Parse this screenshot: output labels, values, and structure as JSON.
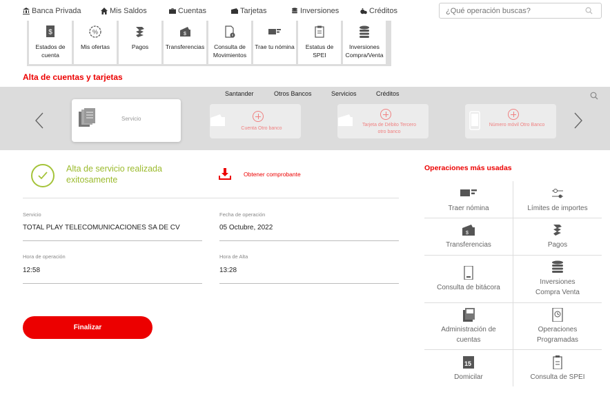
{
  "nav": {
    "banca_privada": "Banca Privada",
    "mis_saldos": "Mis Saldos",
    "cuentas": "Cuentas",
    "tarjetas": "Tarjetas",
    "inversiones": "Inversiones",
    "creditos": "Créditos",
    "search_placeholder": "¿Qué operación buscas?"
  },
  "tiles": [
    {
      "label": "Estados de cuenta",
      "icon": "dollar-doc-icon"
    },
    {
      "label": "Mis ofertas",
      "icon": "percent-badge-icon"
    },
    {
      "label": "Pagos",
      "icon": "hand-coin-icon"
    },
    {
      "label": "Transferencias",
      "icon": "wallet-icon"
    },
    {
      "label": "Consulta de Movimientos",
      "icon": "document-info-icon"
    },
    {
      "label": "Trae tu nómina",
      "icon": "payroll-icon"
    },
    {
      "label": "Estatus de SPEI",
      "icon": "clipboard-icon"
    },
    {
      "label": "Inversiones Compra/Venta",
      "icon": "coin-stack-icon"
    }
  ],
  "section_title": "Alta de cuentas y tarjetas",
  "carousel": {
    "tabs": [
      "Santander",
      "Otros Bancos",
      "Servicios",
      "Créditos"
    ],
    "cards": [
      {
        "label": "Servicio"
      },
      {
        "label": "Cuenta Otro banco"
      },
      {
        "label": "Tarjeta de Débito Tercero otro banco"
      },
      {
        "label": "Número móvil Otro Banco"
      }
    ]
  },
  "result": {
    "success_message": "Alta de servicio realizada exitosamente",
    "receipt_link": "Obtener comprobante",
    "fields": {
      "service_label": "Servicio",
      "service_value": "TOTAL PLAY TELECOMUNICACIONES SA DE CV",
      "op_date_label": "Fecha de operación",
      "op_date_value": "05 Octubre, 2022",
      "op_time_label": "Hora de operación",
      "op_time_value": "12:58",
      "alta_time_label": "Hora de Alta",
      "alta_time_value": "13:28"
    },
    "finish_button": "Finalizar"
  },
  "ops": {
    "title": "Operaciones más usadas",
    "items": [
      {
        "label": "Traer nómina",
        "icon": "payroll-icon"
      },
      {
        "label": "Límites de importes",
        "icon": "sliders-icon"
      },
      {
        "label": "Transferencias",
        "icon": "wallet-icon"
      },
      {
        "label": "Pagos",
        "icon": "hand-coin-icon"
      },
      {
        "label": "Consulta de bitácora",
        "icon": "phone-log-icon"
      },
      {
        "label": "Inversiones\nCompra Venta",
        "icon": "coin-stack-icon"
      },
      {
        "label": "Administración de\ncuentas",
        "icon": "cards-icon"
      },
      {
        "label": "Operaciones\nProgramadas",
        "icon": "clock-doc-icon"
      },
      {
        "label": "Domicilar",
        "icon": "calendar-15-icon"
      },
      {
        "label": "Consulta de SPEI",
        "icon": "clipboard-icon"
      }
    ]
  },
  "colors": {
    "brand_red": "#ec0000",
    "success_green": "#9cbb2e"
  }
}
